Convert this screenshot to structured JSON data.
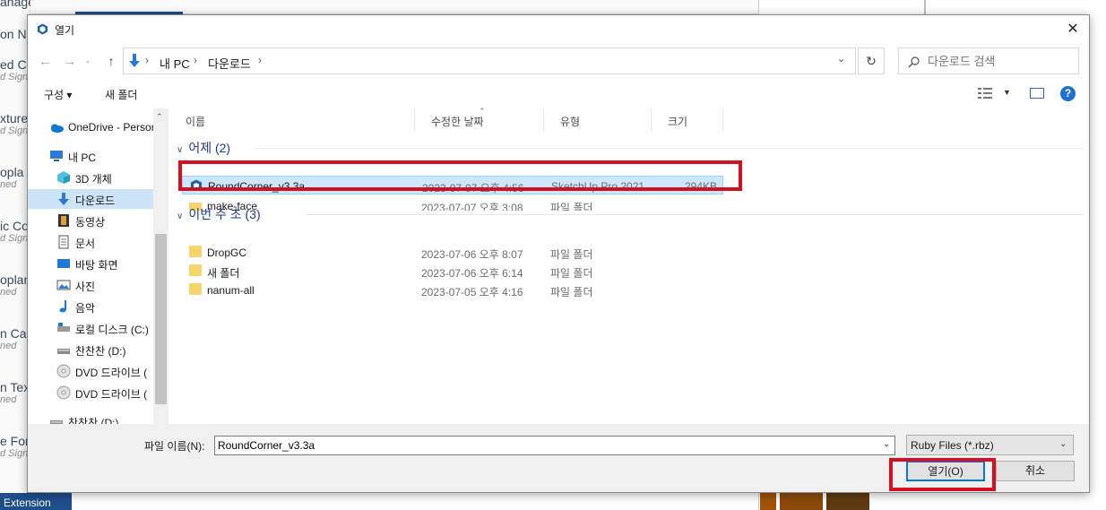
{
  "background_app": {
    "left_items": [
      {
        "title": "on N",
        "sub": ""
      },
      {
        "title": "ed C",
        "sub": "d Sign"
      },
      {
        "title": "xture",
        "sub": "d Sign"
      },
      {
        "title": "opla",
        "sub": "ned"
      },
      {
        "title": "ic Co",
        "sub": "d Sign"
      },
      {
        "title": "oplan",
        "sub": "ned"
      },
      {
        "title": "n Car",
        "sub": "ned"
      },
      {
        "title": "n Tex",
        "sub": "ned"
      },
      {
        "title": "e For",
        "sub": "d Sign"
      }
    ],
    "top_left_fragment": "anager",
    "extension_button": "Extension"
  },
  "dialog": {
    "title": "열기",
    "close_glyph": "✕"
  },
  "address": {
    "crumbs": [
      "내 PC",
      "다운로드"
    ],
    "search_placeholder": "다운로드 검색"
  },
  "toolbar": {
    "organize": "구성 ▾",
    "new_folder": "새 폴더"
  },
  "nav": {
    "items": [
      {
        "label": "OneDrive - Persor",
        "icon": "onedrive-icon"
      },
      {
        "label": "내 PC",
        "icon": "pc-icon"
      },
      {
        "label": "3D 개체",
        "icon": "3d-objects-icon"
      },
      {
        "label": "다운로드",
        "icon": "downloads-icon",
        "selected": true
      },
      {
        "label": "동영상",
        "icon": "videos-icon"
      },
      {
        "label": "문서",
        "icon": "documents-icon"
      },
      {
        "label": "바탕 화면",
        "icon": "desktop-icon"
      },
      {
        "label": "사진",
        "icon": "pictures-icon"
      },
      {
        "label": "음악",
        "icon": "music-icon"
      },
      {
        "label": "로컬 디스크 (C:)",
        "icon": "local-disk-icon"
      },
      {
        "label": "찬찬찬 (D:)",
        "icon": "drive-icon"
      },
      {
        "label": "DVD 드라이브 (",
        "icon": "dvd-icon"
      },
      {
        "label": "DVD 드라이브 (",
        "icon": "dvd-icon"
      },
      {
        "label": "찬찬찬 (D:)",
        "icon": "drive-icon"
      }
    ]
  },
  "columns": {
    "name": "이름",
    "modified": "수정한 날짜",
    "type": "유형",
    "size": "크기"
  },
  "groups": [
    {
      "label": "어제 (2)",
      "files": [
        {
          "name": "RoundCorner_v3.3a",
          "date": "2023-07-07 오후 4:56",
          "type": "SketchUp Pro 2021",
          "size": "294KB",
          "icon": "sketchup-file-icon",
          "selected": true
        },
        {
          "name": "make-face",
          "date": "2023-07-07 오후 3:08",
          "type": "파일 폴더",
          "size": "",
          "icon": "folder-icon"
        }
      ]
    },
    {
      "label": "이번 주 초 (3)",
      "files": [
        {
          "name": "DropGC",
          "date": "2023-07-06 오후 8:07",
          "type": "파일 폴더",
          "size": "",
          "icon": "folder-icon"
        },
        {
          "name": "새 폴더",
          "date": "2023-07-06 오후 6:14",
          "type": "파일 폴더",
          "size": "",
          "icon": "folder-icon"
        },
        {
          "name": "nanum-all",
          "date": "2023-07-05 오후 4:16",
          "type": "파일 폴더",
          "size": "",
          "icon": "folder-icon"
        }
      ]
    }
  ],
  "bottom": {
    "filename_label": "파일 이름(N):",
    "filename_value": "RoundCorner_v3.3a",
    "filetype": "Ruby Files (*.rbz)",
    "open_button": "열기(O)",
    "cancel_button": "취소"
  },
  "colors": {
    "highlight": "#d40f1e",
    "selection": "#cce8ff",
    "accent": "#0078d7"
  }
}
